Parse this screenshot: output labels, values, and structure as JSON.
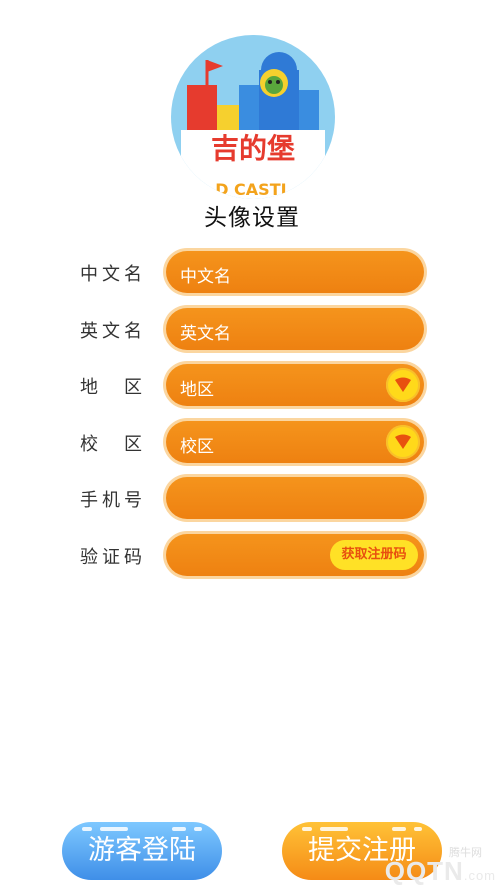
{
  "avatar": {
    "logo_text": "吉的堡",
    "logo_sub": "D CASTL",
    "caption": "头像设置"
  },
  "form": {
    "chinese_name": {
      "label": "中文名",
      "placeholder": "中文名"
    },
    "english_name": {
      "label": "英文名",
      "placeholder": "英文名"
    },
    "region": {
      "label": "地区",
      "value": "地区"
    },
    "campus": {
      "label": "校区",
      "value": "校区"
    },
    "phone": {
      "label": "手机号",
      "value": ""
    },
    "verify_code": {
      "label": "验证码",
      "value": "",
      "button": "获取注册码"
    }
  },
  "buttons": {
    "guest_login": "游客登陆",
    "submit_register": "提交注册"
  },
  "watermark": {
    "small": "腾牛网",
    "big": "QQTN",
    "suffix": ".com"
  },
  "colors": {
    "field_orange": "#f08817",
    "guest_blue": "#4b9cf0",
    "submit_orange": "#f79a1f",
    "avatar_bg": "#8fd0f0"
  }
}
